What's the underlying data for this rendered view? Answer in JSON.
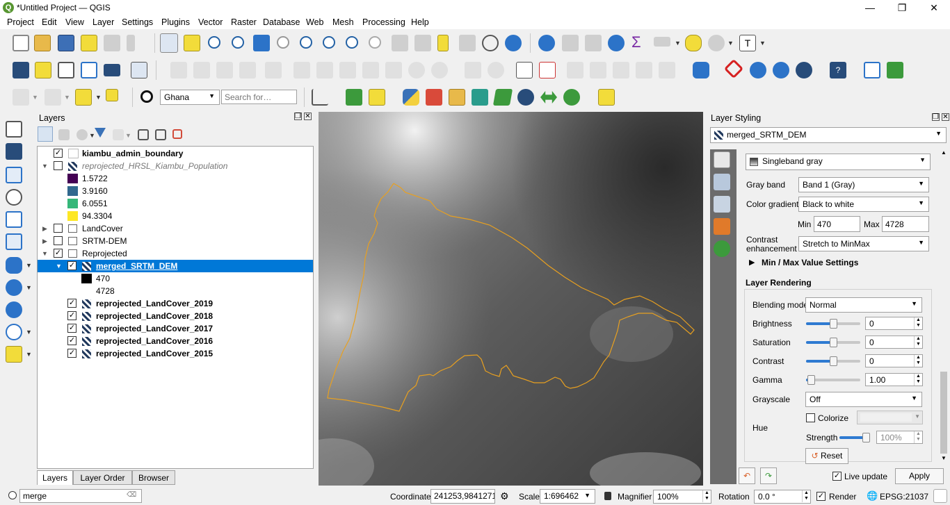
{
  "window": {
    "title": "*Untitled Project — QGIS",
    "logo": "Q"
  },
  "window_controls": {
    "minimize": "—",
    "maximize": "❐",
    "close": "✕"
  },
  "menubar": [
    "Project",
    "Edit",
    "View",
    "Layer",
    "Settings",
    "Plugins",
    "Vector",
    "Raster",
    "Database",
    "Web",
    "Mesh",
    "Processing",
    "Help"
  ],
  "toolbar3": {
    "locator_country": "Ghana",
    "search_placeholder": "Search for…"
  },
  "layers_panel": {
    "title": "Layers",
    "tabs": [
      "Layers",
      "Layer Order",
      "Browser"
    ],
    "filter": "merge",
    "items": [
      {
        "name": "kiambu_admin_boundary",
        "checked": true
      },
      {
        "name": "reprojected_HRSL_Kiambu_Population",
        "checked": false
      },
      {
        "legend": "1.5722",
        "color": "#440154"
      },
      {
        "legend": "3.9160",
        "color": "#31688e"
      },
      {
        "legend": "6.0551",
        "color": "#35b779"
      },
      {
        "legend": "94.3304",
        "color": "#fde725"
      },
      {
        "name": "LandCover",
        "checked": false
      },
      {
        "name": "SRTM-DEM",
        "checked": false
      },
      {
        "name": "Reprojected",
        "checked": true
      },
      {
        "name": "merged_SRTM_DEM",
        "checked": true
      },
      {
        "legend": "470",
        "color": "#000000"
      },
      {
        "legend": "4728",
        "color": "#ffffff"
      },
      {
        "name": "reprojected_LandCover_2019",
        "checked": true
      },
      {
        "name": "reprojected_LandCover_2018",
        "checked": true
      },
      {
        "name": "reprojected_LandCover_2017",
        "checked": true
      },
      {
        "name": "reprojected_LandCover_2016",
        "checked": true
      },
      {
        "name": "reprojected_LandCover_2015",
        "checked": true
      }
    ]
  },
  "styling": {
    "title": "Layer Styling",
    "layer": "merged_SRTM_DEM",
    "renderer": "Singleband gray",
    "gray_band_label": "Gray band",
    "gray_band": "Band 1 (Gray)",
    "color_gradient_label": "Color gradient",
    "color_gradient": "Black to white",
    "min_label": "Min",
    "min": "470",
    "max_label": "Max",
    "max": "4728",
    "contrast_label_1": "Contrast",
    "contrast_label_2": "enhancement",
    "contrast": "Stretch to MinMax",
    "minmax_settings": "Min / Max Value Settings",
    "layer_rendering": "Layer Rendering",
    "blending_label": "Blending mode",
    "blending": "Normal",
    "brightness_label": "Brightness",
    "brightness": "0",
    "saturation_label": "Saturation",
    "saturation": "0",
    "contrast2_label": "Contrast",
    "contrast2": "0",
    "gamma_label": "Gamma",
    "gamma": "1.00",
    "grayscale_label": "Grayscale",
    "grayscale": "Off",
    "hue_label": "Hue",
    "colorize_label": "Colorize",
    "strength_label": "Strength",
    "strength": "100%",
    "reset": "Reset",
    "live_update": "Live update",
    "apply": "Apply",
    "brightness_level": 0.5,
    "saturation_level": 0.5,
    "contrast_level": 0.5,
    "gamma_level": 0.1,
    "strength_level": 1.0
  },
  "statusbar": {
    "coordinate_label": "Coordinate",
    "coordinate": "241253,9841271",
    "scale_label": "Scale",
    "scale": "1:696462",
    "magnifier_label": "Magnifier",
    "magnifier": "100%",
    "rotation_label": "Rotation",
    "rotation": "0.0 °",
    "render": "Render",
    "crs": "EPSG:21037"
  }
}
